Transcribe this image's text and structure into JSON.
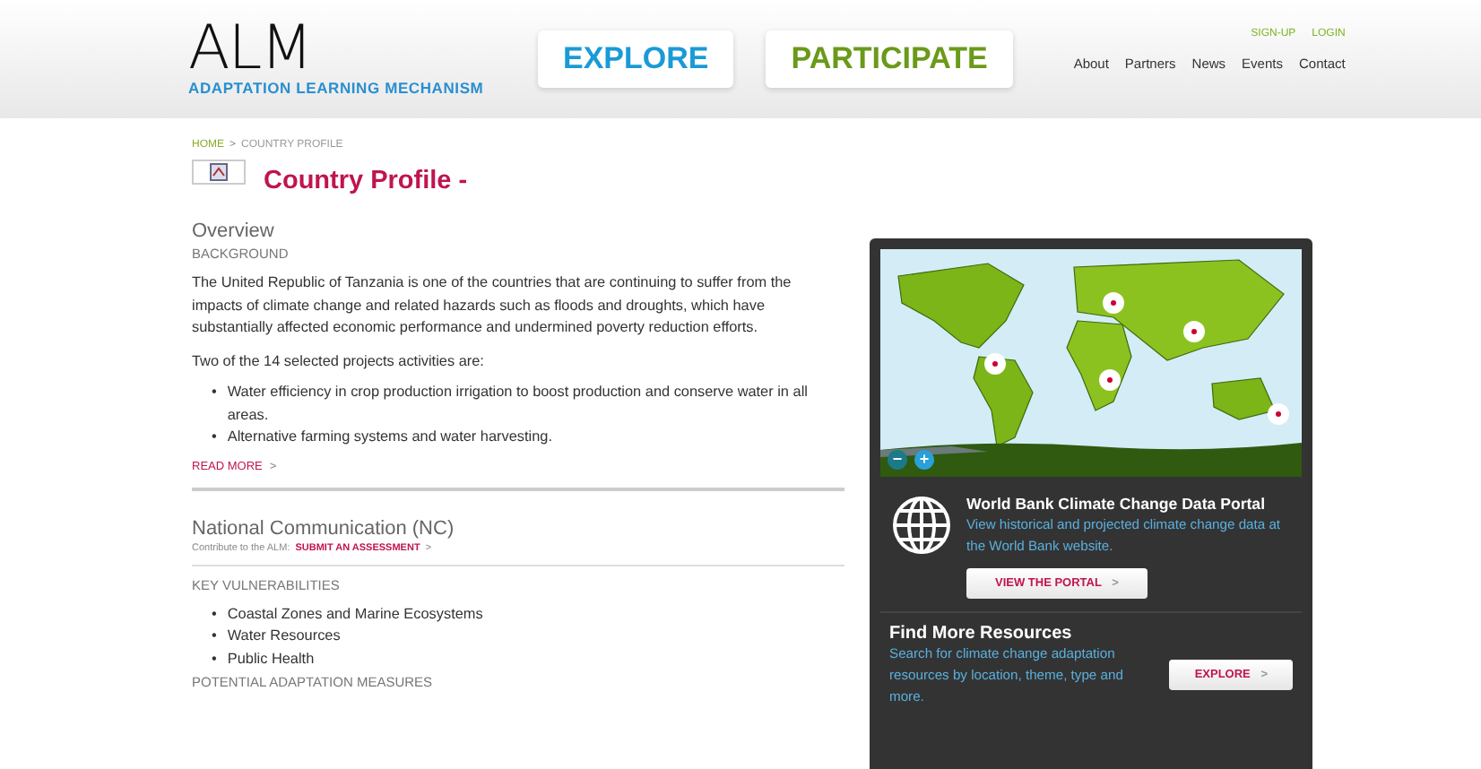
{
  "logo": {
    "mark": "ALM",
    "tagline": "ADAPTATION LEARNING MECHANISM"
  },
  "main_buttons": [
    {
      "label": "EXPLORE",
      "color": "#1a9ad6"
    },
    {
      "label": "PARTICIPATE",
      "color": "#6a9a1a"
    }
  ],
  "account_links": [
    "SIGN-UP",
    "LOGIN"
  ],
  "nav": [
    "About",
    "Partners",
    "News",
    "Events",
    "Contact"
  ],
  "breadcrumb": {
    "home": "HOME",
    "separator": ">",
    "current": "COUNTRY PROFILE"
  },
  "page_title": "Country Profile -",
  "overview": {
    "heading": "Overview",
    "subheading": "BACKGROUND",
    "paragraphs": [
      "The United Republic of Tanzania is one of the countries that are continuing to suffer from the impacts of climate change and related hazards such as floods and droughts, which have substantially affected economic performance and undermined poverty reduction efforts.",
      "Two of the 14 selected projects activities are:"
    ],
    "bullets": [
      "Water efficiency in crop production irrigation to boost production and conserve water in all areas.",
      "Alternative farming systems and water harvesting."
    ],
    "read_more": "READ MORE",
    "read_more_arrow": ">"
  },
  "bullet": "•",
  "nc": {
    "heading": "National Communication (NC)",
    "contribute": "Contribute to the ALM:",
    "submit": "SUBMIT AN ASSESSMENT",
    "submit_arrow": ">",
    "vulnerabilities_heading": "KEY VULNERABILITIES",
    "vulnerabilities": [
      "Coastal Zones and Marine Ecosystems",
      "Water Resources",
      "Public Health"
    ],
    "next_heading": "POTENTIAL ADAPTATION MEASURES"
  },
  "map": {
    "kind": "picture",
    "zoom_out": "−",
    "zoom_in": "+"
  },
  "portal": {
    "title": "World Bank Climate Change Data Portal",
    "text": "View historical and projected climate change data at the World Bank website.",
    "button": "VIEW THE PORTAL",
    "arrow": ">"
  },
  "resources": {
    "title": "Find More Resources",
    "text": "Search for climate change adaptation resources by location, theme, type and more.",
    "button": "EXPLORE",
    "arrow": ">"
  }
}
